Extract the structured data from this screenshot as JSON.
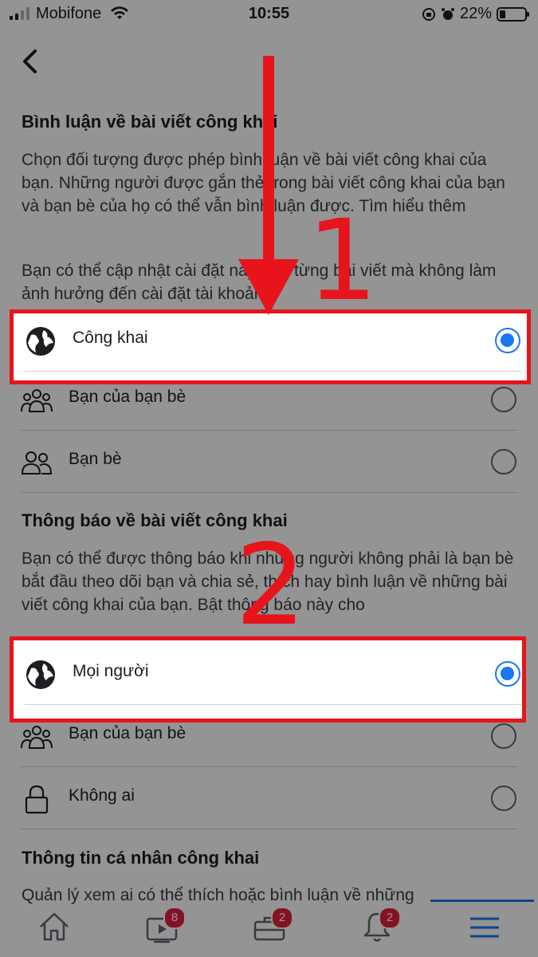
{
  "status_bar": {
    "carrier": "Mobifone",
    "time": "10:55",
    "battery": "22%",
    "battery_level": 0.22
  },
  "section1": {
    "title": "Bình luận về bài viết công khai",
    "description_main": "Chọn đối tượng được phép bình luận về bài viết công khai của bạn. Những người được gắn thẻ trong bài viết công khai của bạn và bạn bè của họ có thể vẫn bình luận được. ",
    "learn_more": "Tìm hiểu thêm",
    "description_2": "Bạn có thể cập nhật cài đặt này trên từng bài viết mà không làm ảnh hưởng đến cài đặt tài khoản.",
    "options": [
      {
        "label": "Công khai",
        "icon": "globe-icon",
        "selected": true
      },
      {
        "label": "Bạn của bạn bè",
        "icon": "friends-of-friends-icon",
        "selected": false
      },
      {
        "label": "Bạn bè",
        "icon": "friends-icon",
        "selected": false
      }
    ]
  },
  "section2": {
    "title": "Thông báo về bài viết công khai",
    "description": "Bạn có thể được thông báo khi những người không phải là bạn bè bắt đầu theo dõi bạn và chia sẻ, thích hay bình luận về những bài viết công khai của bạn. Bật thông báo này cho",
    "options": [
      {
        "label": "Mọi người",
        "icon": "globe-icon",
        "selected": true
      },
      {
        "label": "Bạn của bạn bè",
        "icon": "friends-of-friends-icon",
        "selected": false
      },
      {
        "label": "Không ai",
        "icon": "lock-icon",
        "selected": false
      }
    ]
  },
  "section3": {
    "title": "Thông tin cá nhân công khai",
    "description": "Quản lý xem ai có thể thích hoặc bình luận về những"
  },
  "annotations": {
    "step1": "1",
    "step2": "2",
    "color": "#e8141b"
  },
  "tab_bar": {
    "tabs": [
      {
        "name": "home",
        "icon": "home-icon",
        "badge": ""
      },
      {
        "name": "watch",
        "icon": "video-icon",
        "badge": "8"
      },
      {
        "name": "marketplace",
        "icon": "briefcase-icon",
        "badge": "2"
      },
      {
        "name": "notifications",
        "icon": "bell-icon",
        "badge": "2"
      },
      {
        "name": "menu",
        "icon": "menu-icon",
        "badge": ""
      }
    ],
    "active_color": "#1877f2"
  }
}
